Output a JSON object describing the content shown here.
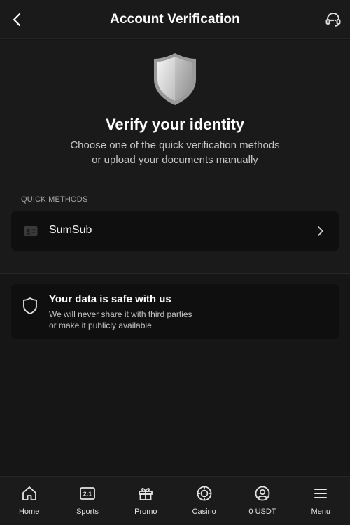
{
  "header": {
    "title": "Account Verification",
    "back_icon": "chevron-left-icon",
    "support_icon": "headset-icon"
  },
  "hero": {
    "icon": "shield-icon",
    "title": "Verify your identity",
    "subtitle_line1": "Choose one of the quick verification methods",
    "subtitle_line2": "or upload your documents manually"
  },
  "quick_methods": {
    "section_label": "QUICK METHODS",
    "items": [
      {
        "label": "SumSub",
        "icon": "id-card-icon"
      }
    ]
  },
  "safety": {
    "title": "Your data is safe with us",
    "line1": "We will never share it with third parties",
    "line2": "or make it publicly available"
  },
  "nav": {
    "items": [
      {
        "label": "Home",
        "icon": "home-icon"
      },
      {
        "label": "Sports",
        "icon": "scoreboard-icon",
        "icon_text": "2:1"
      },
      {
        "label": "Promo",
        "icon": "gift-icon"
      },
      {
        "label": "Casino",
        "icon": "casino-chip-icon"
      },
      {
        "label": "0 USDT",
        "icon": "user-icon"
      },
      {
        "label": "Menu",
        "icon": "menu-icon"
      }
    ]
  },
  "colors": {
    "background": "#161616",
    "surface": "#1a1a1a",
    "card": "#0f0f0f",
    "text_primary": "#ffffff",
    "text_secondary": "#c9c9c9"
  }
}
